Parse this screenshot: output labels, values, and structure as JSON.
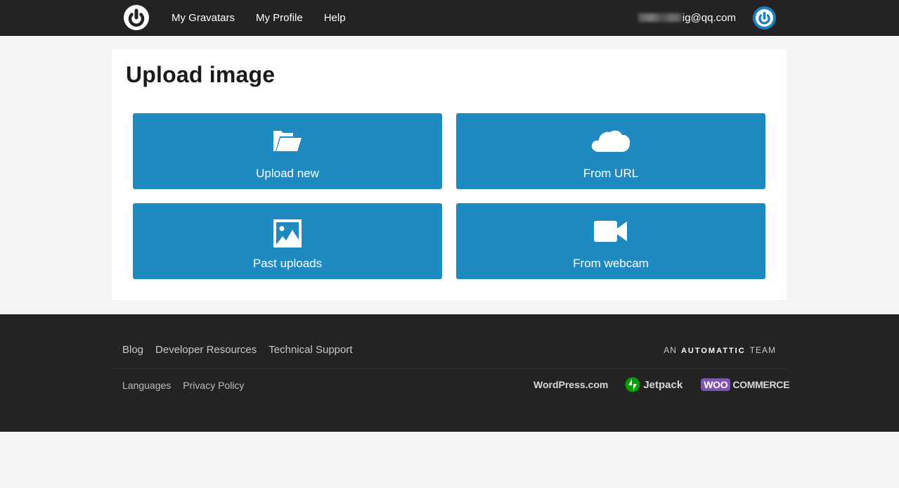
{
  "topbar": {
    "nav": [
      "My Gravatars",
      "My Profile",
      "Help"
    ],
    "email_visible": "ig@qq.com"
  },
  "main": {
    "title": "Upload image",
    "tiles": [
      {
        "label": "Upload new",
        "icon": "folder-open-icon"
      },
      {
        "label": "From URL",
        "icon": "cloud-icon"
      },
      {
        "label": "Past uploads",
        "icon": "image-icon"
      },
      {
        "label": "From webcam",
        "icon": "video-camera-icon"
      }
    ]
  },
  "footer": {
    "links_primary": [
      "Blog",
      "Developer Resources",
      "Technical Support"
    ],
    "team_prefix": "AN",
    "team_brand": "AUTOMATTIC",
    "team_suffix": "TEAM",
    "links_secondary": [
      "Languages",
      "Privacy Policy"
    ],
    "brands": {
      "wordpress": "WordPress.com",
      "jetpack": "Jetpack",
      "woo": "WOO",
      "commerce": "COMMERCE"
    }
  },
  "colors": {
    "topbar_bg": "#232323",
    "tile_bg": "#1f8ac0",
    "page_bg": "#f4f4f4",
    "jetpack_green": "#069e08",
    "woo_purple": "#7f54b3"
  }
}
